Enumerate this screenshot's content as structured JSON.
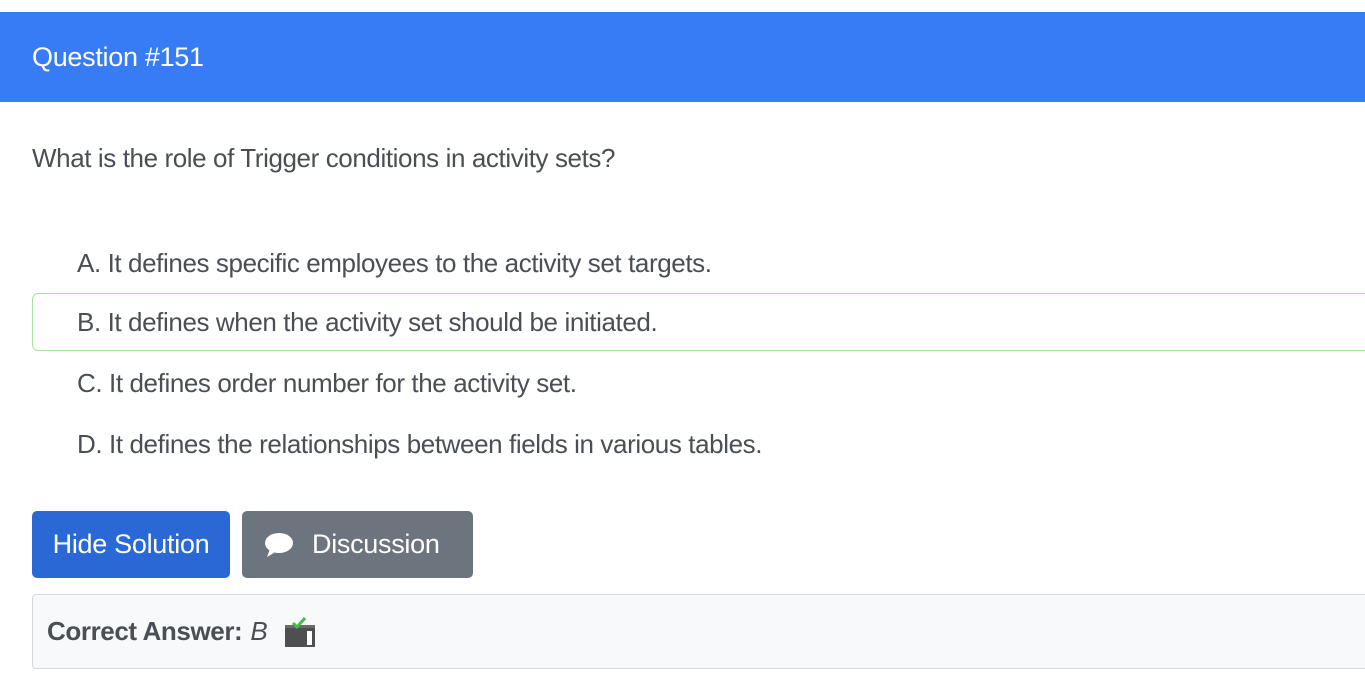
{
  "header": {
    "title": "Question #151"
  },
  "question": {
    "text": "What is the role of Trigger conditions in activity sets?"
  },
  "choices": [
    {
      "text": "A. It defines specific employees to the activity set targets."
    },
    {
      "text": "B. It defines when the activity set should be initiated."
    },
    {
      "text": "C. It defines order number for the activity set."
    },
    {
      "text": "D. It defines the relationships between fields in various tables."
    }
  ],
  "buttons": {
    "hide_solution": "Hide Solution",
    "discussion": "Discussion"
  },
  "answer": {
    "label": "Correct Answer:",
    "value": "B"
  },
  "colors": {
    "header": "#377bf5",
    "primary_button": "#2a68d6",
    "secondary_button": "#6c757d",
    "correct_border": "#a9e3a0"
  },
  "icons": {
    "discussion": "speech-bubble-icon",
    "vote": "vote-box-icon"
  }
}
